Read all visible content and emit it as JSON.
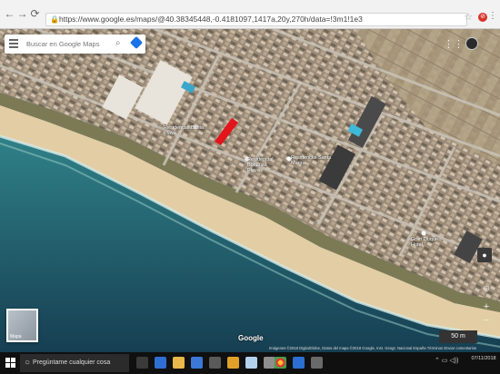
{
  "browser": {
    "url": "https://www.google.es/maps/@40.38345448,-0.4181097,1417a,20y,270h/data=!3m1!1e3",
    "back_icon": "back-arrow-icon",
    "forward_icon": "forward-arrow-icon",
    "reload_icon": "reload-icon",
    "lock_icon": "lock-icon",
    "star_icon": "star-icon",
    "extension_icon": "adblock-icon",
    "menu_icon": "menu-dots-icon"
  },
  "map": {
    "search_placeholder": "Buscar en Google Maps",
    "place_labels": [
      "Residencial Bahia Playa",
      "Residencial Bonanza Playa",
      "Residencial Santa Marina",
      "Gran Duque Hotel"
    ],
    "layer_label": "Mapa",
    "logo": "Google",
    "attribution": "Imágenes ©2018 DigitalGlobe, Datos del mapa ©2018 Google, Inst. Geogr. Nacional   España   Términos   Enviar comentarios",
    "scale": "50 m",
    "highlight_color": "#e3141b"
  },
  "taskbar": {
    "search_text": "Pregúntame cualquier cosa",
    "date": "07/11/2018",
    "icons": [
      "start-icon",
      "task-view-icon",
      "edge-icon",
      "explorer-icon",
      "store-icon",
      "chrome-icon",
      "mail-icon",
      "app-icon"
    ]
  }
}
